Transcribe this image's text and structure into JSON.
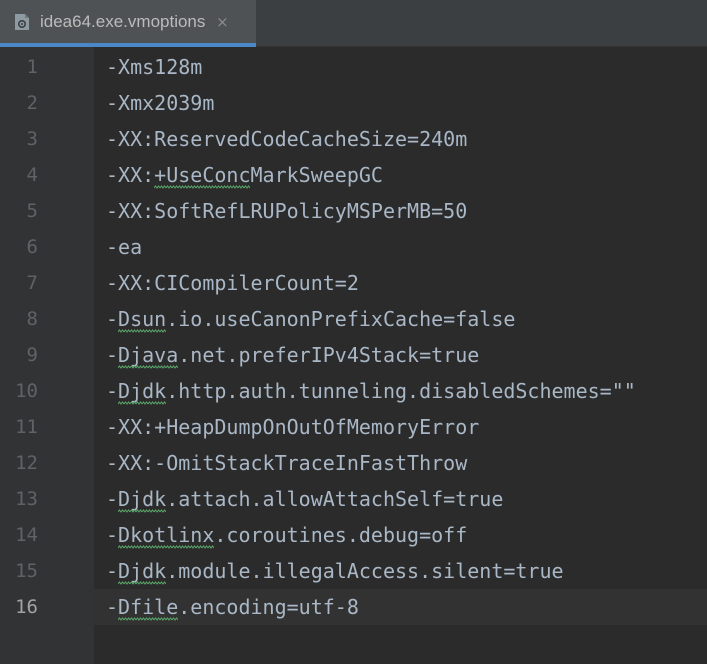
{
  "tab": {
    "title": "idea64.exe.vmoptions",
    "icon": "settings-file-icon",
    "close_glyph": "×",
    "accent_color": "#4a88c7"
  },
  "editor": {
    "current_line": 16,
    "lines": [
      {
        "number": "1",
        "text": "-Xms128m"
      },
      {
        "number": "2",
        "text": "-Xmx2039m"
      },
      {
        "number": "3",
        "text": "-XX:ReservedCodeCacheSize=240m"
      },
      {
        "number": "4",
        "text": "-XX:+UseConcMarkSweepGC"
      },
      {
        "number": "5",
        "text": "-XX:SoftRefLRUPolicyMSPerMB=50"
      },
      {
        "number": "6",
        "text": "-ea"
      },
      {
        "number": "7",
        "text": "-XX:CICompilerCount=2"
      },
      {
        "number": "8",
        "text": "-Dsun.io.useCanonPrefixCache=false"
      },
      {
        "number": "9",
        "text": "-Djava.net.preferIPv4Stack=true"
      },
      {
        "number": "10",
        "text": "-Djdk.http.auth.tunneling.disabledSchemes=\"\""
      },
      {
        "number": "11",
        "text": "-XX:+HeapDumpOnOutOfMemoryError"
      },
      {
        "number": "12",
        "text": "-XX:-OmitStackTraceInFastThrow"
      },
      {
        "number": "13",
        "text": "-Djdk.attach.allowAttachSelf=true"
      },
      {
        "number": "14",
        "text": "-Dkotlinx.coroutines.debug=off"
      },
      {
        "number": "15",
        "text": "-Djdk.module.illegalAccess.silent=true"
      },
      {
        "number": "16",
        "text": "-Dfile.encoding=utf-8"
      }
    ]
  }
}
